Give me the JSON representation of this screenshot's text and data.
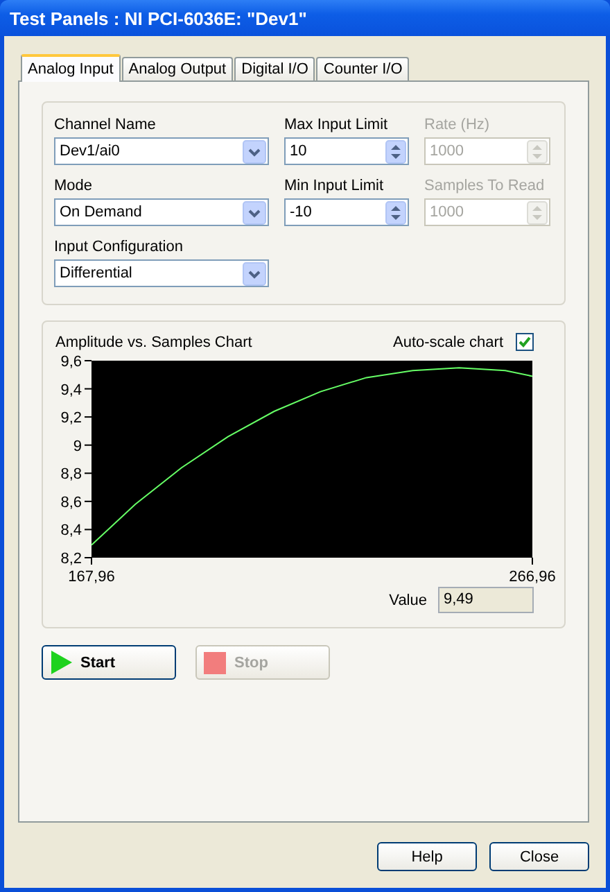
{
  "window": {
    "title": "Test Panels : NI PCI-6036E: \"Dev1\""
  },
  "tabs": [
    {
      "label": "Analog Input",
      "selected": true
    },
    {
      "label": "Analog Output",
      "selected": false
    },
    {
      "label": "Digital I/O",
      "selected": false
    },
    {
      "label": "Counter I/O",
      "selected": false
    }
  ],
  "config": {
    "fields": [
      {
        "kind": "dropdown",
        "label": "Channel Name",
        "value": "Dev1/ai0",
        "disabled": false
      },
      {
        "kind": "spinner",
        "label": "Max Input Limit",
        "value": "10",
        "disabled": false
      },
      {
        "kind": "spinner",
        "label": "Rate (Hz)",
        "value": "1000",
        "disabled": true
      },
      {
        "kind": "dropdown",
        "label": "Mode",
        "value": "On Demand",
        "disabled": false
      },
      {
        "kind": "spinner",
        "label": "Min Input Limit",
        "value": "-10",
        "disabled": false
      },
      {
        "kind": "spinner",
        "label": "Samples To Read",
        "value": "1000",
        "disabled": true
      },
      {
        "kind": "dropdown",
        "label": "Input Configuration",
        "value": "Differential",
        "disabled": false
      }
    ]
  },
  "chart_panel": {
    "title": "Amplitude vs. Samples Chart",
    "autoscale": {
      "label": "Auto-scale chart",
      "checked": true
    },
    "chart_data": {
      "type": "line",
      "x": [
        167.96,
        177.8,
        188.2,
        198.6,
        209.0,
        219.4,
        229.7,
        240.1,
        250.5,
        260.9,
        266.96
      ],
      "series": [
        {
          "color": "#66ff66",
          "values": [
            8.29,
            8.58,
            8.84,
            9.06,
            9.24,
            9.38,
            9.48,
            9.53,
            9.55,
            9.53,
            9.49
          ]
        }
      ],
      "xlim": [
        167.96,
        266.96
      ],
      "ylim": [
        8.2,
        9.6
      ],
      "xticks": [
        {
          "value": 167.96,
          "label": "167,96"
        },
        {
          "value": 266.96,
          "label": "266,96"
        }
      ],
      "yticks": [
        {
          "value": 9.6,
          "label": "9,6"
        },
        {
          "value": 9.4,
          "label": "9,4"
        },
        {
          "value": 9.2,
          "label": "9,2"
        },
        {
          "value": 9,
          "label": "9"
        },
        {
          "value": 8.8,
          "label": "8,8"
        },
        {
          "value": 8.6,
          "label": "8,6"
        },
        {
          "value": 8.4,
          "label": "8,4"
        },
        {
          "value": 8.2,
          "label": "8,2"
        }
      ]
    },
    "value_label": "Value",
    "value": "9,49"
  },
  "actions": [
    {
      "kind": "start",
      "label": "Start",
      "disabled": false
    },
    {
      "kind": "stop",
      "label": "Stop",
      "disabled": true
    }
  ],
  "buttons": [
    "Help",
    "Close"
  ]
}
